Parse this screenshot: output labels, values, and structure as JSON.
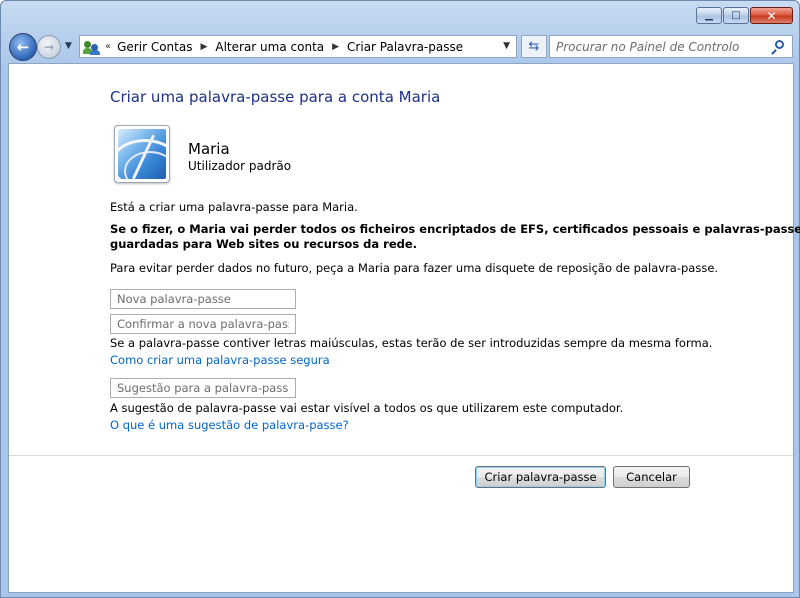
{
  "window": {
    "minimize_glyph": "▁",
    "maximize_glyph": "□",
    "close_glyph": "✕"
  },
  "navigation": {
    "back_glyph": "←",
    "forward_glyph": "→",
    "history_dropdown_glyph": "▼",
    "breadcrumb_chevron": "«",
    "breadcrumbs": [
      "Gerir Contas",
      "Alterar uma conta",
      "Criar Palavra-passe"
    ],
    "breadcrumb_separator": "▶",
    "address_dropdown_glyph": "▼",
    "refresh_glyph": "⇆",
    "search_placeholder": "Procurar no Painel de Controlo"
  },
  "page": {
    "title": "Criar uma palavra-passe para a conta Maria",
    "user": {
      "name": "Maria",
      "account_type": "Utilizador padrão"
    },
    "intro": "Está a criar uma palavra-passe para Maria.",
    "warning_line1": "Se o fizer, o Maria vai perder todos os ficheiros encriptados de EFS, certificados pessoais e palavras-passe",
    "warning_line2": "guardadas para Web sites ou recursos da rede.",
    "advice": "Para evitar perder dados no futuro, peça a Maria para fazer uma disquete de reposição de palavra-passe.",
    "fields": {
      "new_password_placeholder": "Nova palavra-passe",
      "confirm_password_placeholder": "Confirmar a nova palavra-passe",
      "hint_placeholder": "Sugestão para a palavra-passe"
    },
    "case_note": "Se a palavra-passe contiver letras maiúsculas, estas terão de ser introduzidas sempre da mesma forma.",
    "strong_password_link": "Como criar uma palavra-passe segura",
    "hint_note": "A sugestão de palavra-passe vai estar visível a todos os que utilizarem este computador.",
    "hint_help_link": "O que é uma sugestão de palavra-passe?"
  },
  "buttons": {
    "create": "Criar palavra-passe",
    "cancel": "Cancelar"
  },
  "colors": {
    "title": "#1e3287",
    "link": "#0066cc",
    "window_frame": "#b9d1ee"
  }
}
